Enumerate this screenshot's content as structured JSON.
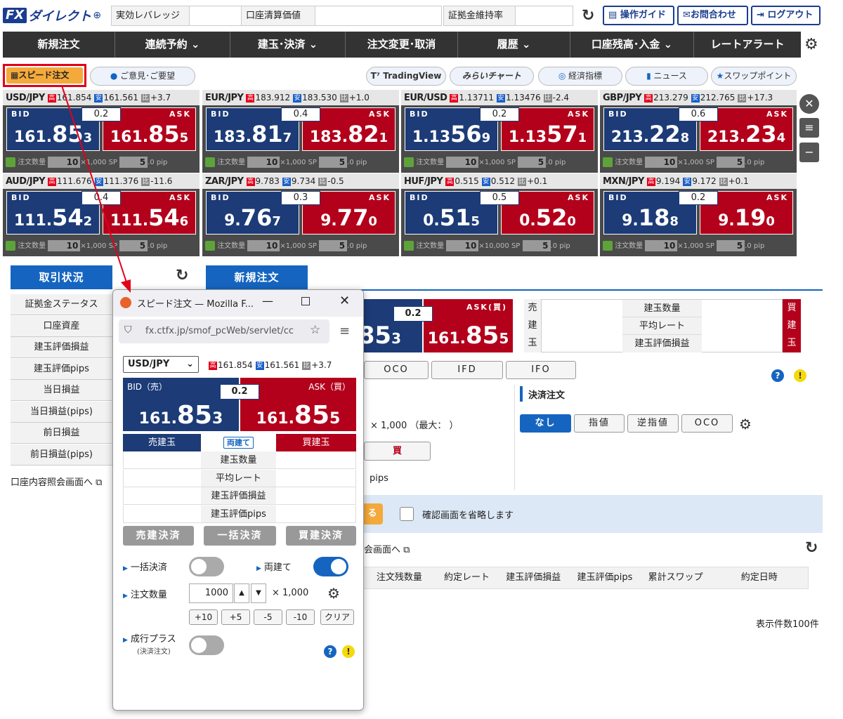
{
  "header": {
    "logo_fx": "FX",
    "logo_text": "ダイレクト",
    "logo_plus": "⊕",
    "leverage_label": "実効レバレッジ",
    "account_value_label": "口座清算価値",
    "margin_rate_label": "証拠金維持率",
    "guide_label": "操作ガイド",
    "contact_label": "お問合わせ",
    "logout_label": "ログアウト"
  },
  "nav": [
    "新規注文",
    "連続予約 ⌄",
    "建玉･決済 ⌄",
    "注文変更･取消",
    "履歴 ⌄",
    "口座残高･入金 ⌄",
    "レートアラート"
  ],
  "toolbar": {
    "speed_order": "スピード注文",
    "feedback": "ご意見･ご要望",
    "tradingview": "TradingView",
    "mirai_chart": "みらいチャート",
    "econ": "経済指標",
    "news": "ニュース",
    "swap": "スワップポイント"
  },
  "rates": [
    {
      "sym": "USD/JPY",
      "high": "161.854",
      "low": "161.561",
      "chg": "+3.7",
      "spread": "0.2",
      "bid": [
        "161.",
        "85",
        "3"
      ],
      "ask": [
        "161.",
        "85",
        "5"
      ],
      "qty": "10",
      "unit": "×1,000",
      "sp": "5",
      "spu": ".0 pip"
    },
    {
      "sym": "EUR/JPY",
      "high": "183.912",
      "low": "183.530",
      "chg": "+1.0",
      "spread": "0.4",
      "bid": [
        "183.",
        "81",
        "7"
      ],
      "ask": [
        "183.",
        "82",
        "1"
      ],
      "qty": "10",
      "unit": "×1,000",
      "sp": "5",
      "spu": ".0 pip"
    },
    {
      "sym": "EUR/USD",
      "high": "1.13711",
      "low": "1.13476",
      "chg": "-2.4",
      "spread": "0.2",
      "bid": [
        "1.13",
        "56",
        "9"
      ],
      "ask": [
        "1.13",
        "57",
        "1"
      ],
      "qty": "10",
      "unit": "×1,000",
      "sp": "5",
      "spu": ".0 pip"
    },
    {
      "sym": "GBP/JPY",
      "high": "213.279",
      "low": "212.765",
      "chg": "+17.3",
      "spread": "0.6",
      "bid": [
        "213.",
        "22",
        "8"
      ],
      "ask": [
        "213.",
        "23",
        "4"
      ],
      "qty": "10",
      "unit": "×1,000",
      "sp": "5",
      "spu": ".0 pip"
    },
    {
      "sym": "AUD/JPY",
      "high": "111.676",
      "low": "111.376",
      "chg": "-11.6",
      "spread": "0.4",
      "bid": [
        "111.",
        "54",
        "2"
      ],
      "ask": [
        "111.",
        "54",
        "6"
      ],
      "qty": "10",
      "unit": "×1,000",
      "sp": "5",
      "spu": ".0 pip"
    },
    {
      "sym": "ZAR/JPY",
      "high": "9.783",
      "low": "9.734",
      "chg": "-0.5",
      "spread": "0.3",
      "bid": [
        "9.",
        "76",
        "7"
      ],
      "ask": [
        "9.",
        "77",
        "0"
      ],
      "qty": "10",
      "unit": "×1,000",
      "sp": "5",
      "spu": ".0 pip"
    },
    {
      "sym": "HUF/JPY",
      "high": "0.515",
      "low": "0.512",
      "chg": "+0.1",
      "spread": "0.5",
      "bid": [
        "0.",
        "51",
        "5"
      ],
      "ask": [
        "0.",
        "52",
        "0"
      ],
      "qty": "10",
      "unit": "×10,000",
      "sp": "5",
      "spu": ".0 pip"
    },
    {
      "sym": "MXN/JPY",
      "high": "9.194",
      "low": "9.172",
      "chg": "+0.1",
      "spread": "0.2",
      "bid": [
        "9.",
        "18",
        "8"
      ],
      "ask": [
        "9.",
        "19",
        "0"
      ],
      "qty": "10",
      "unit": "×1,000",
      "sp": "5",
      "spu": ".0 pip"
    }
  ],
  "rate_labels": {
    "bid": "BID",
    "ask": "ASK",
    "qty": "注文数量",
    "sp": "SP",
    "high": "高",
    "low": "安",
    "chg": "比"
  },
  "lower": {
    "tab_status": "取引状況",
    "tab_new": "新規注文",
    "left_rows": [
      "証拠金ステータス",
      "口座資産",
      "建玉評価損益",
      "建玉評価pips",
      "当日損益",
      "当日損益(pips)",
      "前日損益",
      "前日損益(pips)"
    ],
    "account_link": "口座内容照会画面へ",
    "ask_buy": "ASK(買)",
    "main_spread": "0.2",
    "main_bid_frag": [
      "",
      "85",
      "3"
    ],
    "main_ask": [
      "161.",
      "85",
      "5"
    ],
    "pos_side_sell": "売建玉",
    "pos_side_buy": "買建玉",
    "pos_qty": "建玉数量",
    "pos_avg": "平均レート",
    "pos_pl": "建玉評価損益",
    "oco": "OCO",
    "ifd": "IFD",
    "ifo": "IFO",
    "settle_title": "決済注文",
    "settle_opts": [
      "なし",
      "指値",
      "逆指値",
      "OCO"
    ],
    "qty_text": "× 1,000 （最大：  ）",
    "buy": "買",
    "pips": "pips",
    "confirm_btn_tail": "る",
    "confirm_skip": "確認画面を省略します",
    "meeting_link": "会画面へ",
    "cols": [
      "注文残数量",
      "約定レート",
      "建玉評価損益",
      "建玉評価pips",
      "累計スワップ",
      "約定日時"
    ],
    "count": "表示件数100件"
  },
  "popup": {
    "title": "スピード注文 — Mozilla F...",
    "url": "fx.ctfx.jp/smof_pcWeb/servlet/cc",
    "pair": "USD/JPY",
    "high": "161.854",
    "low": "161.561",
    "chg": "+3.7",
    "bid_label": "BID（売）",
    "ask_label": "ASK（買）",
    "spread": "0.2",
    "bid": [
      "161.",
      "85",
      "3"
    ],
    "ask": [
      "161.",
      "85",
      "5"
    ],
    "sell_pos": "売建玉",
    "hedge": "両建て",
    "buy_pos": "買建玉",
    "rows": [
      "建玉数量",
      "平均レート",
      "建玉評価損益",
      "建玉評価pips"
    ],
    "sell_settle": "売建決済",
    "bulk_settle": "一括決済",
    "buy_settle": "買建決済",
    "bulk_toggle": "一括決済",
    "bulk_on": false,
    "hedge_toggle": "両建て",
    "hedge_on": true,
    "qty_label": "注文数量",
    "qty_value": "1000",
    "qty_unit": "× 1,000",
    "steps": [
      "+10",
      "+5",
      "-5",
      "-10",
      "クリア"
    ],
    "market_plus": "成行プラス",
    "market_plus_sub": "(決済注文)",
    "market_on": false
  },
  "colors": {
    "nav": "#333333",
    "bid": "#1c3b77",
    "ask": "#b3001b",
    "accent": "#1565c0",
    "highlight": "#e2001a"
  }
}
